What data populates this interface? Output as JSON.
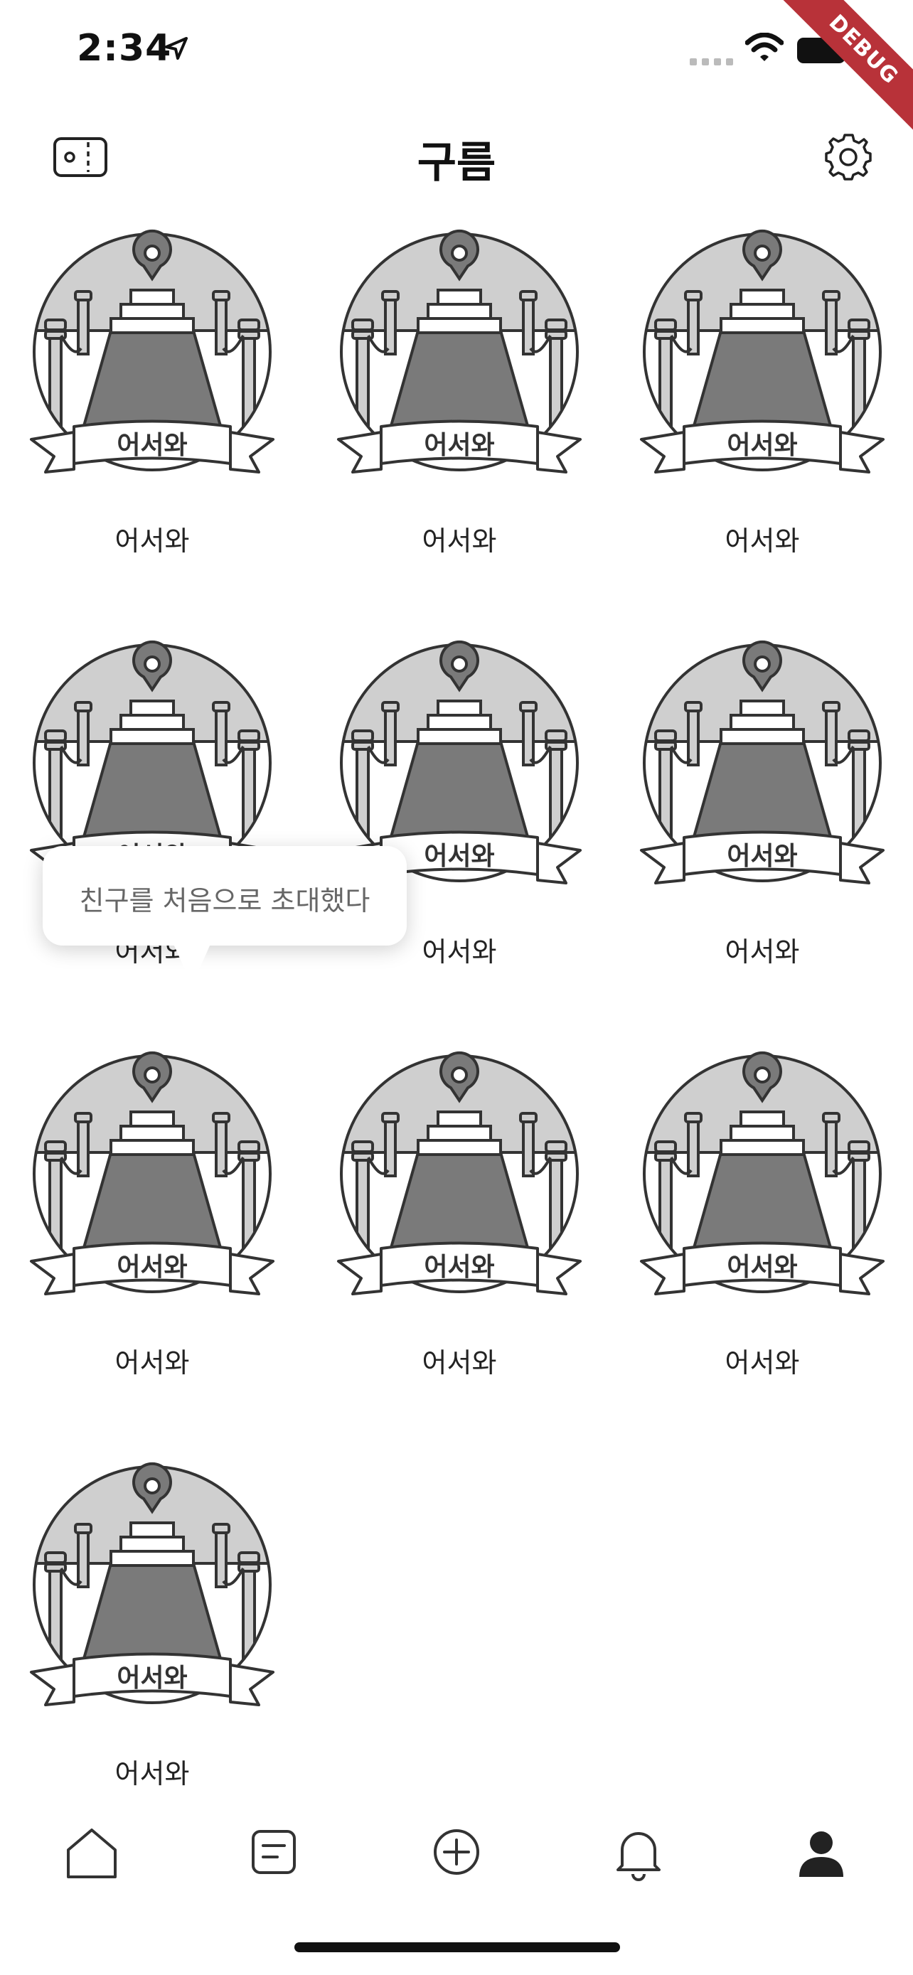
{
  "status_bar": {
    "time": "2:34",
    "debug_label": "DEBUG"
  },
  "header": {
    "title": "구름",
    "left_icon": "ticket-icon",
    "right_icon": "gear-icon"
  },
  "badges": [
    {
      "label": "어서와",
      "ribbon_text": "어서와"
    },
    {
      "label": "어서와",
      "ribbon_text": "어서와"
    },
    {
      "label": "어서와",
      "ribbon_text": "어서와"
    },
    {
      "label": "어서와",
      "ribbon_text": "어서와"
    },
    {
      "label": "어서와",
      "ribbon_text": "어서와"
    },
    {
      "label": "어서와",
      "ribbon_text": "어서와"
    },
    {
      "label": "어서와",
      "ribbon_text": "어서와"
    },
    {
      "label": "어서와",
      "ribbon_text": "어서와"
    },
    {
      "label": "어서와",
      "ribbon_text": "어서와"
    },
    {
      "label": "어서와",
      "ribbon_text": "어서와"
    }
  ],
  "tooltip": {
    "text": "친구를 처음으로 초대했다"
  },
  "bottom_nav": {
    "items": [
      "home-icon",
      "document-icon",
      "add-circle-icon",
      "bell-icon",
      "profile-icon"
    ],
    "active": "profile-icon"
  },
  "colors": {
    "badge_light": "#cfcfcf",
    "badge_mid": "#7a7a7a",
    "outline": "#333333",
    "tooltip_text": "#666666"
  }
}
